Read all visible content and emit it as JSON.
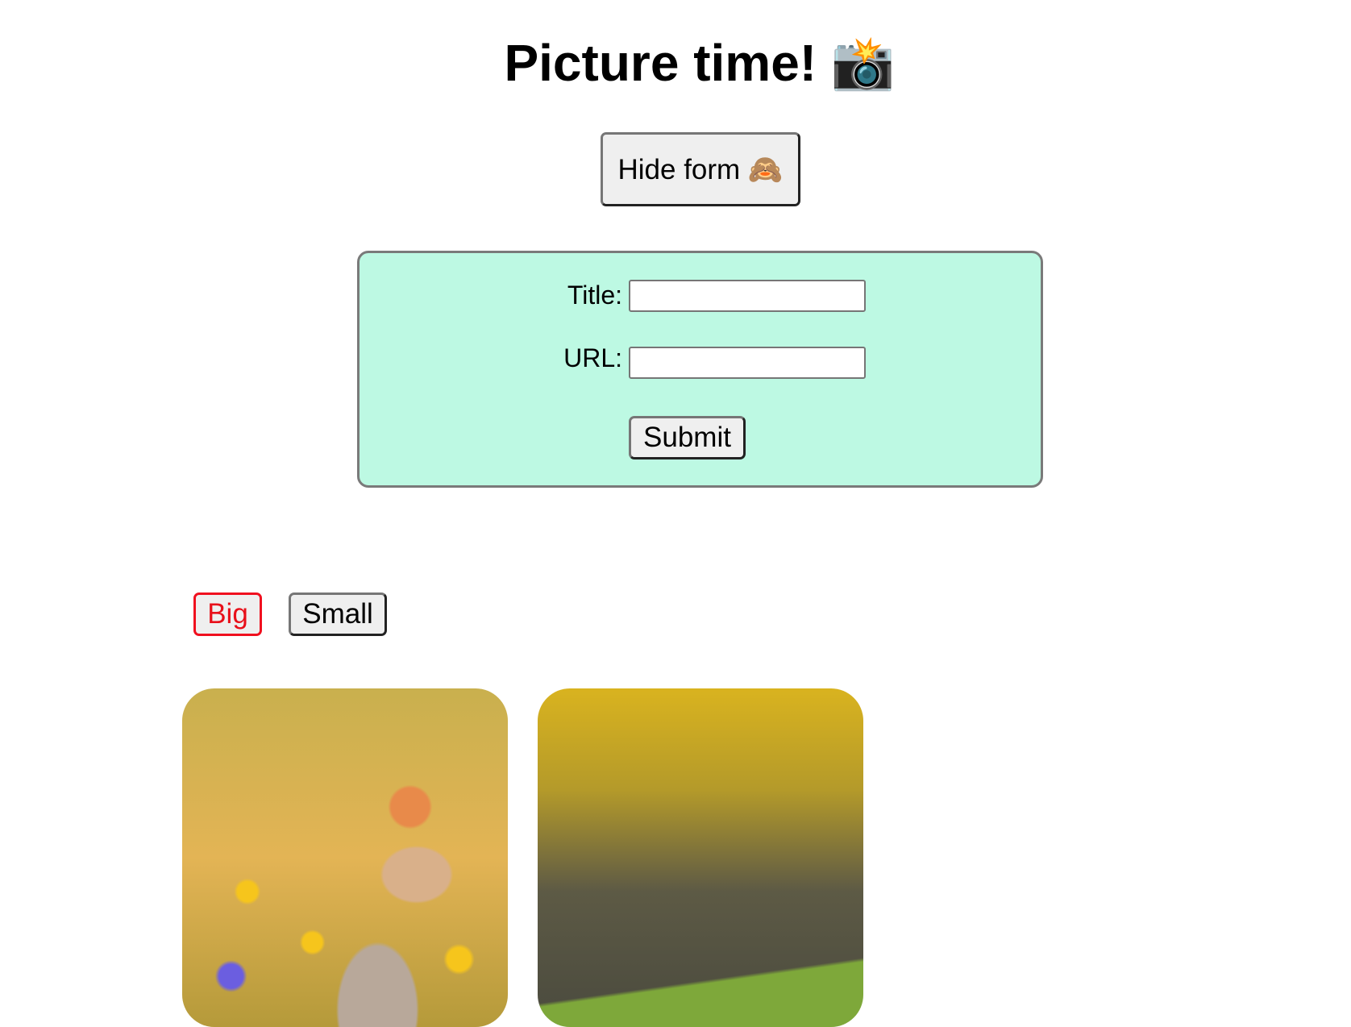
{
  "page": {
    "title": "Picture time! 📸"
  },
  "toggle_form_button": "Hide form 🙈",
  "form": {
    "title_label": "Title:",
    "title_value": "",
    "url_label": "URL:",
    "url_value": "",
    "submit_label": "Submit"
  },
  "size_controls": {
    "big_label": "Big",
    "small_label": "Small",
    "active": "Big",
    "active_color": "#e8101a"
  },
  "form_background": "#bdf9e3"
}
